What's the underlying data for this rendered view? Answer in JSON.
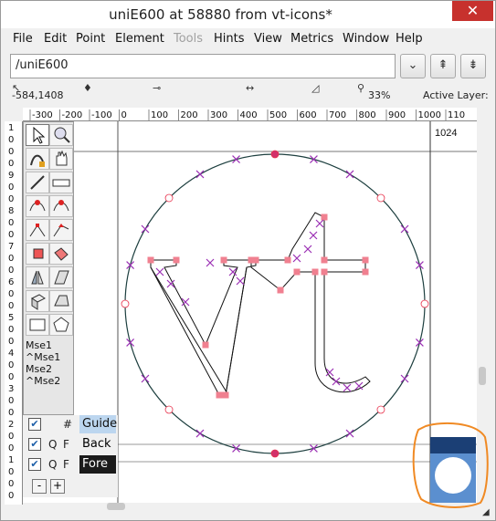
{
  "window": {
    "title": "uniE600 at 58880 from vt-icons*",
    "close_glyph": "✕"
  },
  "menu": [
    "File",
    "Edit",
    "Point",
    "Element",
    "Tools",
    "Hints",
    "View",
    "Metrics",
    "Window",
    "Help"
  ],
  "menu_disabled": [
    "Tools"
  ],
  "glyph_field": {
    "value": "/uniE600"
  },
  "toolbar_buttons": [
    {
      "name": "dropdown",
      "glyph": "⌄"
    },
    {
      "name": "prev-glyph",
      "glyph": "⇞"
    },
    {
      "name": "next-glyph",
      "glyph": "⇟"
    }
  ],
  "status": {
    "coords": "-584,1408",
    "zoom": "33%",
    "active_layer_label": "Active Layer:"
  },
  "rulers": {
    "h_ticks": [
      "-300",
      "-200",
      "-100",
      "0",
      "100",
      "200",
      "300",
      "400",
      "500",
      "600",
      "700",
      "800",
      "900",
      "1000",
      "110"
    ],
    "v_ticks": [
      "1",
      "0",
      "0",
      "0",
      "9",
      "0",
      "0",
      "8",
      "0",
      "0",
      "7",
      "0",
      "0",
      "6",
      "0",
      "0",
      "5",
      "0",
      "0",
      "4",
      "0",
      "0",
      "3",
      "0",
      "0",
      "2",
      "0",
      "0",
      "1",
      "0",
      "0",
      "0"
    ]
  },
  "canvas": {
    "width_label": "1024",
    "accent_outline": "#1d3f3f",
    "point_color": "#e8304a",
    "cross_color": "#9b2fb4"
  },
  "tools": {
    "mse_labels": [
      "Mse1",
      "^Mse1",
      "Mse2",
      "^Mse2"
    ]
  },
  "layers": [
    {
      "q": "#",
      "f": "",
      "name": "Guide",
      "style": "sel"
    },
    {
      "q": "Q",
      "f": "F",
      "name": "Back",
      "style": ""
    },
    {
      "q": "Q",
      "f": "F",
      "name": "Fore",
      "style": "fore"
    }
  ],
  "layer_buttons": [
    "-",
    "+"
  ]
}
